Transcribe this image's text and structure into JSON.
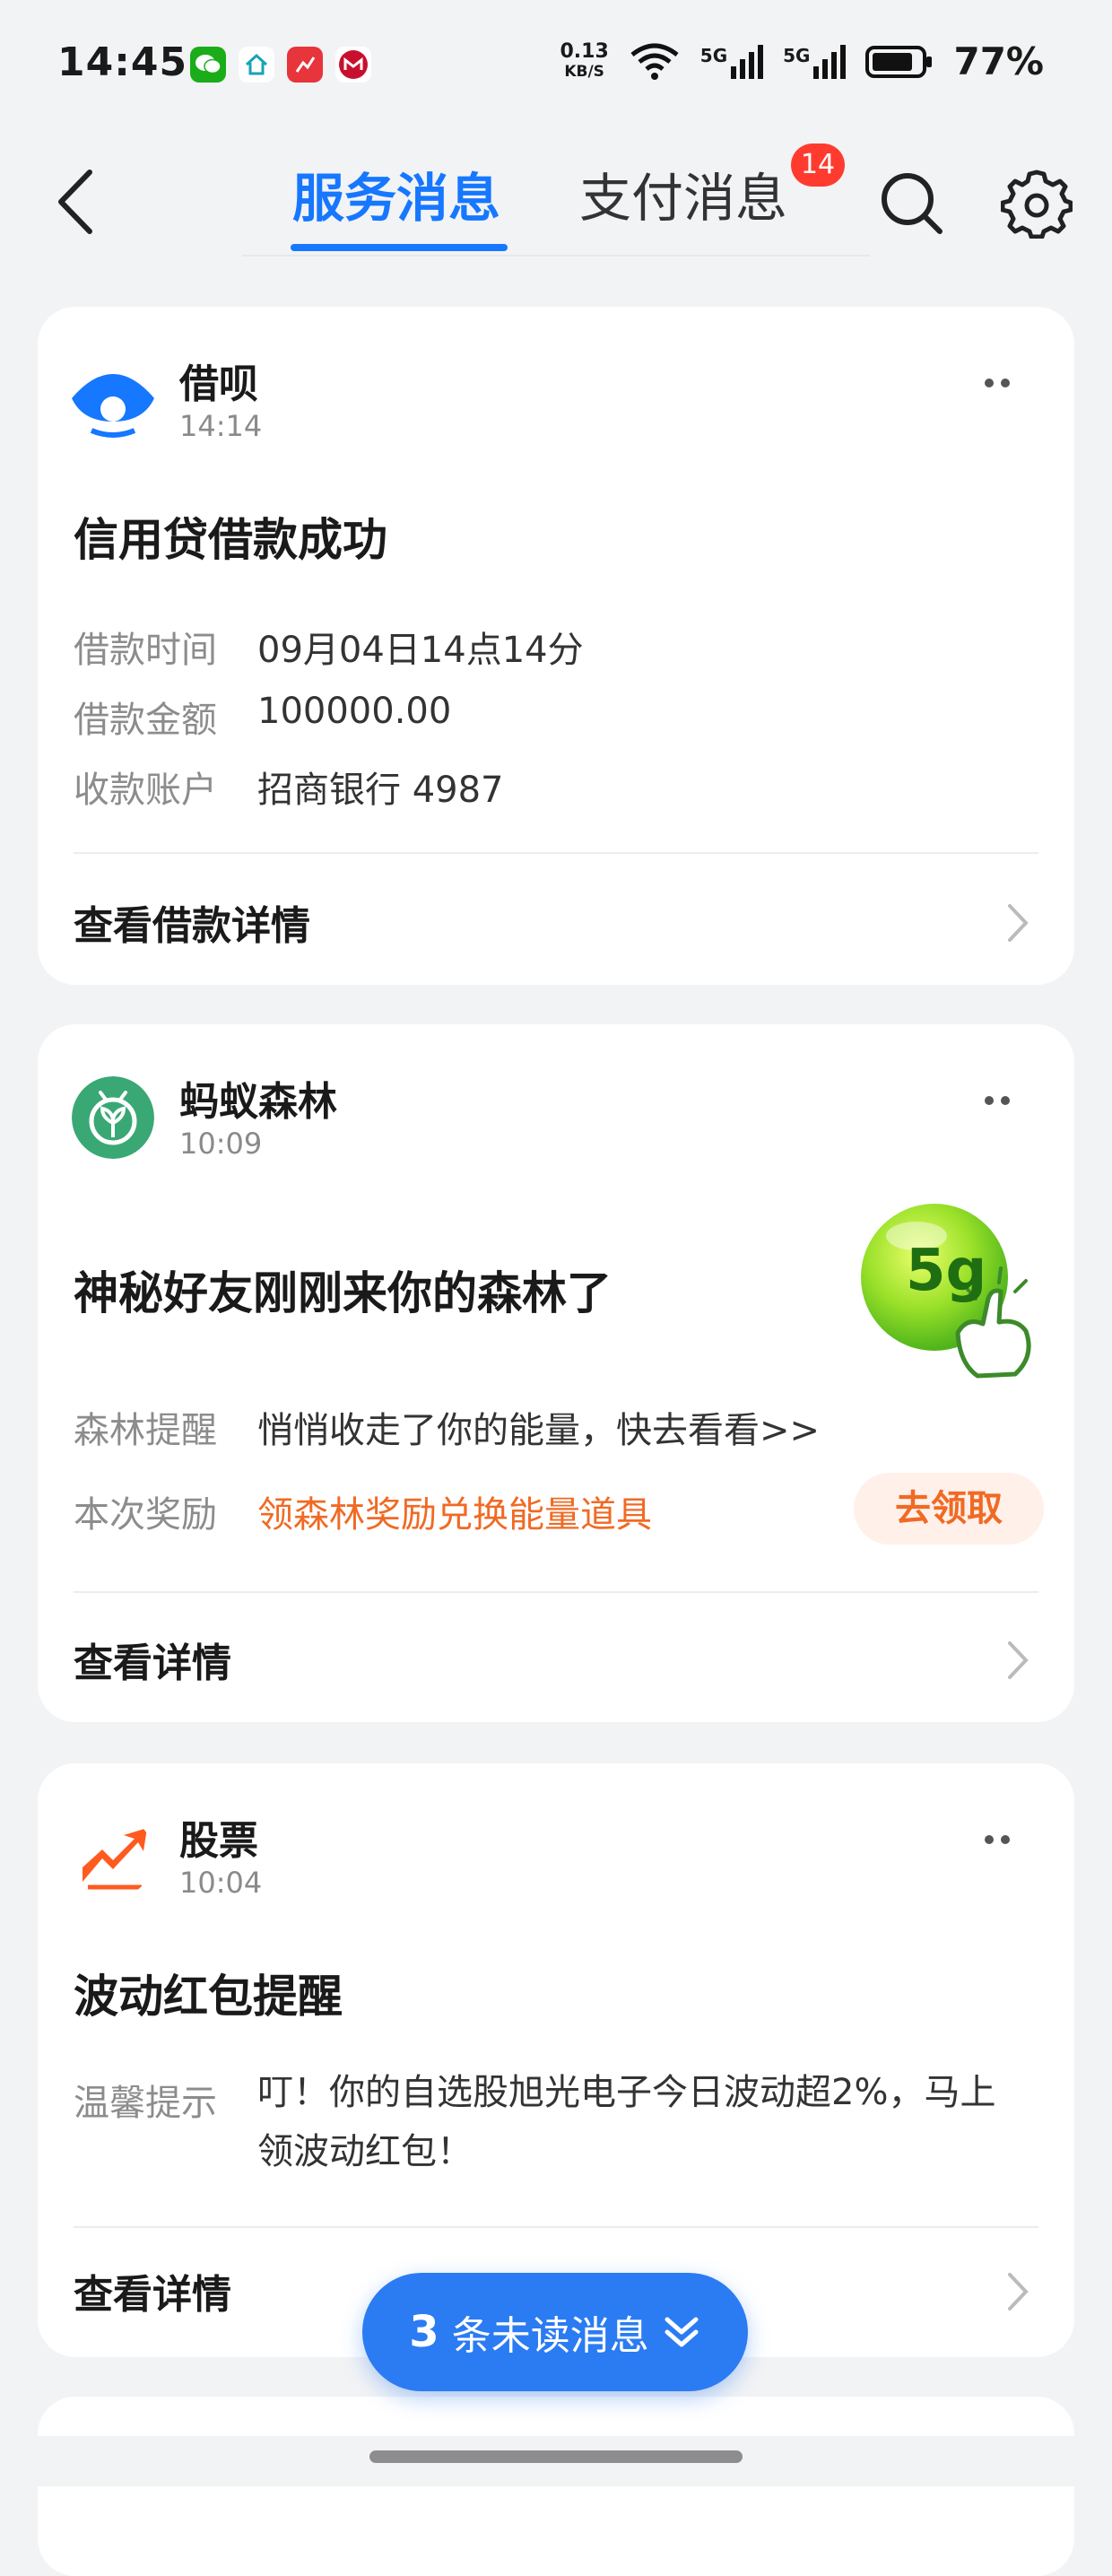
{
  "status_bar": {
    "time": "14:45",
    "speed_value": "0.13",
    "speed_unit": "KB/S",
    "network": "5G",
    "battery": "77%",
    "icons": [
      "wechat-icon",
      "home-app-icon",
      "stock-app-icon",
      "bank-app-icon",
      "wifi-icon",
      "signal-icon",
      "battery-icon"
    ]
  },
  "header": {
    "tabs": [
      {
        "label": "服务消息",
        "active": true
      },
      {
        "label": "支付消息",
        "active": false,
        "badge": "14"
      }
    ]
  },
  "cards": [
    {
      "name": "借呗",
      "time": "14:14",
      "title": "信用贷借款成功",
      "rows": [
        {
          "label": "借款时间",
          "value": "09月04日14点14分"
        },
        {
          "label": "借款金额",
          "value": "100000.00"
        },
        {
          "label": "收款账户",
          "value": "招商银行 4987"
        }
      ],
      "footer": "查看借款详情"
    },
    {
      "name": "蚂蚁森林",
      "time": "10:09",
      "title": "神秘好友刚刚来你的森林了",
      "energy": "5g",
      "rows": [
        {
          "label": "森林提醒",
          "value": "悄悄收走了你的能量，快去看看>>"
        },
        {
          "label": "本次奖励",
          "value": "领森林奖励兑换能量道具"
        }
      ],
      "action": "去领取",
      "footer": "查看详情"
    },
    {
      "name": "股票",
      "time": "10:04",
      "title": "波动红包提醒",
      "rows": [
        {
          "label": "温馨提示",
          "value_line1": "叮！你的自选股旭光电子今日波动超2%，马上",
          "value_line2": "领波动红包！"
        }
      ],
      "footer": "查看详情"
    }
  ],
  "unread": {
    "count": "3",
    "label": "条未读消息"
  },
  "colors": {
    "accent": "#1677ff",
    "orange": "#f06a24",
    "badge": "#ff3b30",
    "pill": "#2b7bf3"
  }
}
